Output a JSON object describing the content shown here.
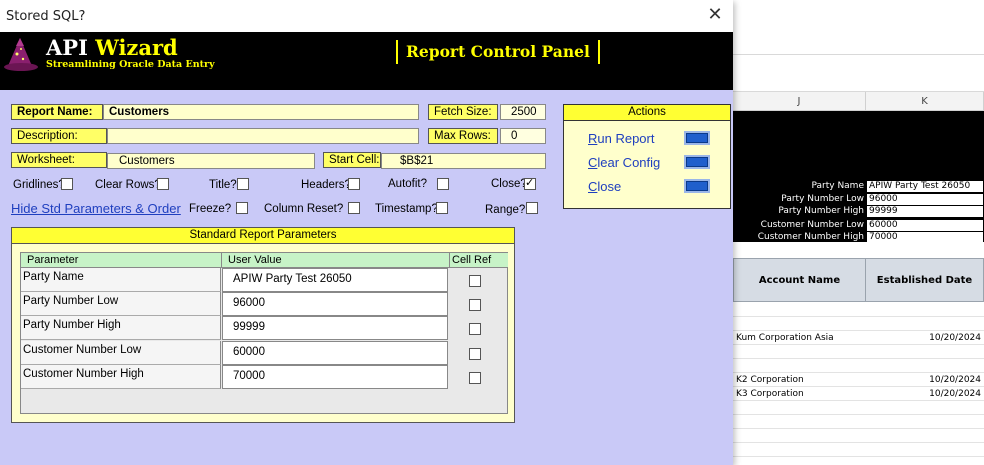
{
  "window": {
    "title": "Stored SQL?",
    "close_glyph": "✕"
  },
  "banner": {
    "brand_prefix": "API",
    "brand_suffix": "Wizard",
    "tagline": "Streamlining Oracle Data Entry",
    "panel_title": "Report Control Panel",
    "logo_icon": "wizard-hat-icon"
  },
  "form": {
    "report_name_label": "Report Name:",
    "report_name_value": "Customers",
    "fetch_size_label": "Fetch Size:",
    "fetch_size_value": "2500",
    "description_label": "Description:",
    "description_value": "",
    "max_rows_label": "Max Rows:",
    "max_rows_value": "0",
    "worksheet_label": "Worksheet:",
    "worksheet_value": "Customers",
    "start_cell_label": "Start Cell:",
    "start_cell_value": "$B$21"
  },
  "options": {
    "gridlines": {
      "label": "Gridlines?",
      "checked": false
    },
    "clear_rows": {
      "label": "Clear Rows?",
      "checked": false
    },
    "title": {
      "label": "Title?",
      "checked": false
    },
    "headers": {
      "label": "Headers?",
      "checked": false
    },
    "autofit": {
      "label": "Autofit?",
      "checked": false
    },
    "close": {
      "label": "Close?",
      "checked": true
    },
    "freeze": {
      "label": "Freeze?",
      "checked": false
    },
    "column_reset": {
      "label": "Column Reset?",
      "checked": false
    },
    "timestamp": {
      "label": "Timestamp?",
      "checked": false
    },
    "range": {
      "label": "Range?",
      "checked": false
    }
  },
  "hide_link": "Hide Std Parameters & Order",
  "actions": {
    "header": "Actions",
    "items": [
      {
        "label": "Run Report",
        "accel": "R"
      },
      {
        "label": "Clear Config",
        "accel": "C"
      },
      {
        "label": "Close",
        "accel": "C"
      }
    ]
  },
  "std_params": {
    "header": "Standard Report Parameters",
    "columns": [
      "Parameter",
      "User Value",
      "Cell Ref"
    ],
    "rows": [
      {
        "param": "Party Name",
        "value": "APIW Party Test 26050",
        "cell_ref": false
      },
      {
        "param": "Party Number Low",
        "value": "96000",
        "cell_ref": false
      },
      {
        "param": "Party Number High",
        "value": "99999",
        "cell_ref": false
      },
      {
        "param": "Customer Number Low",
        "value": "60000",
        "cell_ref": false
      },
      {
        "param": "Customer Number High",
        "value": "70000",
        "cell_ref": false
      }
    ]
  },
  "sheet": {
    "col_j": "J",
    "col_k": "K",
    "params": [
      {
        "label": "Party Name",
        "value": "APIW Party Test 26050"
      },
      {
        "label": "Party Number Low",
        "value": "96000"
      },
      {
        "label": "Party Number High",
        "value": "99999"
      },
      {
        "label": "Customer Number Low",
        "value": "60000"
      },
      {
        "label": "Customer Number High",
        "value": "70000"
      }
    ],
    "headers": [
      "Account Name",
      "Established Date"
    ],
    "rows": [
      {
        "name": "Kum Corporation Asia",
        "date": "10/20/2024"
      },
      {
        "name": "K2 Corporation",
        "date": "10/20/2024"
      },
      {
        "name": "K3 Corporation",
        "date": "10/20/2024"
      }
    ]
  },
  "colors": {
    "banner_bg": "#000000",
    "brand_yellow": "#ffff00",
    "body_bg": "#c9c9f7",
    "label_yellow": "#ffff66",
    "field_bg": "#ffffcc",
    "grid_header_green": "#c7f3c7",
    "link_blue": "#1f3fbf",
    "button_blue": "#1f5fcc"
  }
}
